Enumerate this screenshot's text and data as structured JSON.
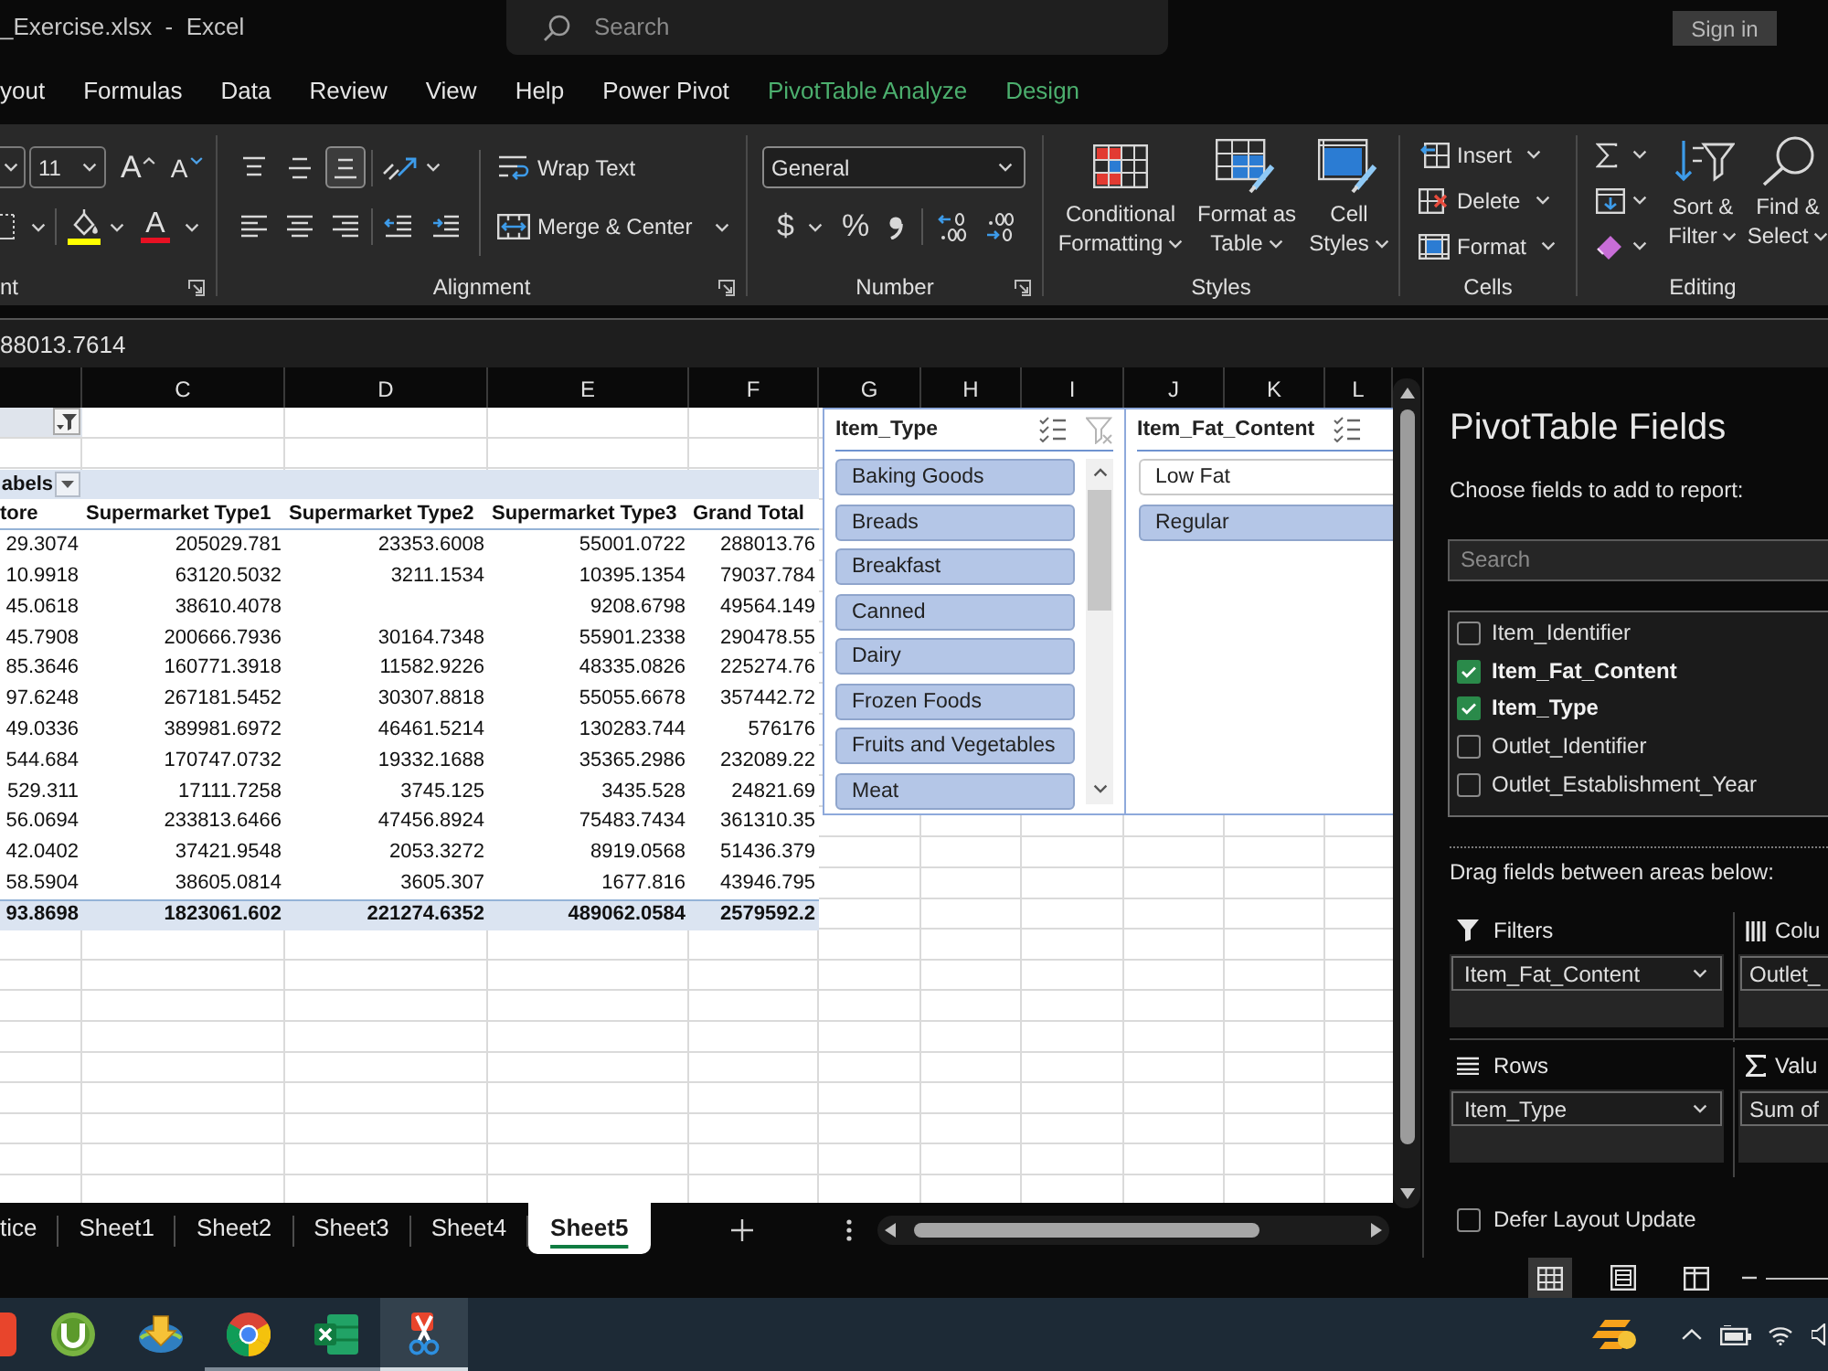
{
  "title_bar": {
    "title": "_Exercise.xlsx  -  Excel",
    "search": {
      "placeholder": "Search"
    },
    "sign_in": "Sign in"
  },
  "menu_tabs": [
    {
      "label": "yout",
      "kind": "standard"
    },
    {
      "label": "Formulas",
      "kind": "standard"
    },
    {
      "label": "Data",
      "kind": "standard"
    },
    {
      "label": "Review",
      "kind": "standard"
    },
    {
      "label": "View",
      "kind": "standard"
    },
    {
      "label": "Help",
      "kind": "standard"
    },
    {
      "label": "Power Pivot",
      "kind": "standard"
    },
    {
      "label": "PivotTable Analyze",
      "kind": "contextual"
    },
    {
      "label": "Design",
      "kind": "contextual"
    }
  ],
  "ribbon": {
    "groups": [
      {
        "kind": "font",
        "label": "nt",
        "launcher": true,
        "font_size": "11",
        "grow_glyph": "A",
        "shrink_glyph": "A",
        "color_glyph": "A"
      },
      {
        "kind": "alignment",
        "label": "Alignment",
        "launcher": true,
        "vertical_align": [
          {
            "kind": "top",
            "selected": false
          },
          {
            "kind": "middle",
            "selected": false
          },
          {
            "kind": "bottom",
            "selected": true
          }
        ],
        "horizontal_align": [
          {
            "kind": "left",
            "selected": false
          },
          {
            "kind": "center",
            "selected": false
          },
          {
            "kind": "right",
            "selected": false
          }
        ],
        "wrap_text": "Wrap Text",
        "merge": "Merge & Center"
      },
      {
        "kind": "number",
        "label": "Number",
        "launcher": true,
        "format": "General",
        "currency": "$",
        "percent": "%"
      },
      {
        "kind": "styles",
        "label": "Styles",
        "launcher": false,
        "buttons": [
          {
            "kind": "conditional",
            "lines": [
              "Conditional",
              "Formatting"
            ]
          },
          {
            "kind": "table",
            "lines": [
              "Format as",
              "Table"
            ]
          },
          {
            "kind": "cell",
            "lines": [
              "Cell",
              "Styles"
            ]
          }
        ]
      },
      {
        "kind": "cells",
        "label": "Cells",
        "launcher": false,
        "buttons": [
          {
            "kind": "insert",
            "label": "Insert"
          },
          {
            "kind": "delete",
            "label": "Delete"
          },
          {
            "kind": "format",
            "label": "Format"
          }
        ]
      },
      {
        "kind": "editing",
        "label": "Editing",
        "launcher": false,
        "buttons": [
          {
            "kind": "sort",
            "lines": [
              "Sort &",
              "Filter"
            ]
          },
          {
            "kind": "find",
            "lines": [
              "Find &",
              "Select"
            ]
          }
        ]
      }
    ]
  },
  "formula_bar": {
    "value": "88013.7614"
  },
  "sheet": {
    "columns": [
      "C",
      "D",
      "E",
      "F",
      "G",
      "H",
      "I",
      "J",
      "K",
      "L"
    ],
    "pivot": {
      "column_labels": "abels",
      "header": [
        "tore",
        "Supermarket Type1",
        "Supermarket Type2",
        "Supermarket Type3",
        "Grand Total"
      ],
      "rows": [
        [
          "29.3074",
          "205029.781",
          "23353.6008",
          "55001.0722",
          "288013.76"
        ],
        [
          "10.9918",
          "63120.5032",
          "3211.1534",
          "10395.1354",
          "79037.784"
        ],
        [
          "45.0618",
          "38610.4078",
          null,
          "9208.6798",
          "49564.149"
        ],
        [
          "45.7908",
          "200666.7936",
          "30164.7348",
          "55901.2338",
          "290478.55"
        ],
        [
          "85.3646",
          "160771.3918",
          "11582.9226",
          "48335.0826",
          "225274.76"
        ],
        [
          "97.6248",
          "267181.5452",
          "30307.8818",
          "55055.6678",
          "357442.72"
        ],
        [
          "49.0336",
          "389981.6972",
          "46461.5214",
          "130283.744",
          "576176"
        ],
        [
          "544.684",
          "170747.0732",
          "19332.1688",
          "35365.2986",
          "232089.22"
        ],
        [
          "529.311",
          "17111.7258",
          "3745.125",
          "3435.528",
          "24821.69"
        ],
        [
          "56.0694",
          "233813.6466",
          "47456.8924",
          "75483.7434",
          "361310.35"
        ],
        [
          "42.0402",
          "37421.9548",
          "2053.3272",
          "8919.0568",
          "51436.379"
        ],
        [
          "58.5904",
          "38605.0814",
          "3605.307",
          "1677.816",
          "43946.795"
        ]
      ],
      "grand_total": [
        "93.8698",
        "1823061.602",
        "221274.6352",
        "489062.0584",
        "2579592.2"
      ]
    }
  },
  "slicers": [
    {
      "title": "Item_Type",
      "clear_filter": {
        "disabled": true
      },
      "scrollable": true,
      "items": [
        {
          "label": "Baking Goods",
          "selected": true
        },
        {
          "label": "Breads",
          "selected": true
        },
        {
          "label": "Breakfast",
          "selected": true
        },
        {
          "label": "Canned",
          "selected": true
        },
        {
          "label": "Dairy",
          "selected": true
        },
        {
          "label": "Frozen Foods",
          "selected": true
        },
        {
          "label": "Fruits and Vegetables",
          "selected": true
        },
        {
          "label": "Meat",
          "selected": true
        }
      ]
    },
    {
      "title": "Item_Fat_Content",
      "scrollable": false,
      "items": [
        {
          "label": "Low Fat",
          "selected": false
        },
        {
          "label": "Regular",
          "selected": true
        }
      ]
    }
  ],
  "field_list": {
    "title": "PivotTable Fields",
    "subtitle": "Choose fields to add to report:",
    "search": {
      "placeholder": "Search"
    },
    "fields": [
      {
        "label": "Item_Identifier",
        "checked": false
      },
      {
        "label": "Item_Fat_Content",
        "checked": true
      },
      {
        "label": "Item_Type",
        "checked": true
      },
      {
        "label": "Outlet_Identifier",
        "checked": false
      },
      {
        "label": "Outlet_Establishment_Year",
        "checked": false
      }
    ],
    "drag_hint": "Drag fields between areas below:",
    "areas": [
      {
        "kind": "filters",
        "label": "Filters",
        "fields": [
          "Item_Fat_Content"
        ]
      },
      {
        "kind": "columns",
        "label": "Colu",
        "fields": [
          "Outlet_"
        ]
      },
      {
        "kind": "rows",
        "label": "Rows",
        "fields": [
          "Item_Type"
        ]
      },
      {
        "kind": "values",
        "label": "Valu",
        "fields": [
          "Sum of"
        ]
      }
    ],
    "defer_update": {
      "label": "Defer Layout Update",
      "checked": false
    }
  },
  "sheet_tabs": [
    {
      "label": "tice",
      "selected": false
    },
    {
      "label": "Sheet1",
      "selected": false
    },
    {
      "label": "Sheet2",
      "selected": false
    },
    {
      "label": "Sheet3",
      "selected": false
    },
    {
      "label": "Sheet4",
      "selected": false
    },
    {
      "label": "Sheet5",
      "selected": true
    }
  ],
  "status_bar": {
    "views": [
      {
        "kind": "normal",
        "selected": true
      },
      {
        "kind": "page_layout",
        "selected": false
      },
      {
        "kind": "page_break",
        "selected": false
      }
    ]
  },
  "taskbar": {
    "apps": [
      {
        "kind": "tile",
        "running": false,
        "selected": false
      },
      {
        "kind": "torrent",
        "running": false,
        "selected": false
      },
      {
        "kind": "download",
        "running": false,
        "selected": false
      },
      {
        "kind": "browser",
        "running": true,
        "selected": false
      },
      {
        "kind": "spreadsheet",
        "running": true,
        "selected": false
      },
      {
        "kind": "snipping",
        "running": true,
        "selected": true
      }
    ]
  }
}
